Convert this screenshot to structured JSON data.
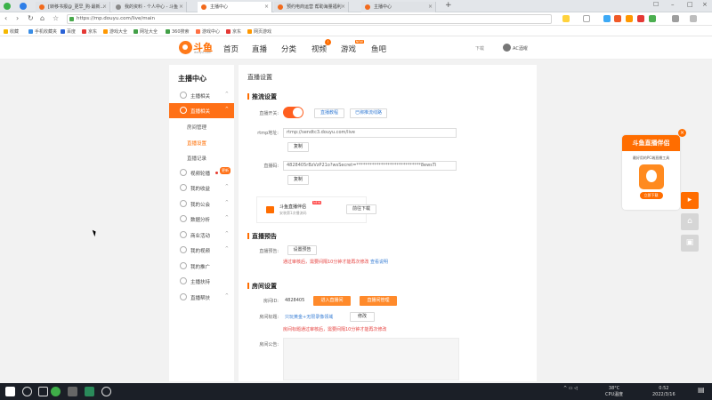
{
  "browser": {
    "tabs": [
      {
        "label": "[转移书报@_更早_购·最新...",
        "active": false
      },
      {
        "label": "我的资料 - 个人中心 - 斗鱼",
        "active": false
      },
      {
        "label": "主播中心",
        "active": true
      },
      {
        "label": "预约电商运营 帮助海量福利",
        "active": false
      },
      {
        "label": "主播中心",
        "active": false
      }
    ],
    "url": "https://mp.douyu.com/live/main",
    "bookmarks": [
      "收藏",
      "手机收藏夹",
      "百度",
      "京东",
      "游戏大全",
      "网址大全",
      "360搜索",
      "游戏中心",
      "京东",
      "网页游戏"
    ]
  },
  "site": {
    "logo_text": "斗鱼",
    "logo_sub": "douyu.com",
    "nav": [
      "首页",
      "直播",
      "分类",
      "视频",
      "游戏",
      "鱼吧"
    ],
    "video_badge": "!",
    "game_badge": "NEW",
    "download": "下载",
    "username": "AC酒曜"
  },
  "sidebar": {
    "title": "主播中心",
    "items": [
      {
        "label": "主播相关",
        "caret": "^"
      },
      {
        "label": "直播相关",
        "caret": "^"
      },
      {
        "label": "视频轮播",
        "caret": "^",
        "badge": "更新"
      },
      {
        "label": "我的收益",
        "caret": "^"
      },
      {
        "label": "我的公会",
        "caret": "^"
      },
      {
        "label": "数据分析",
        "caret": "^"
      },
      {
        "label": "商业活动",
        "caret": "^"
      },
      {
        "label": "我的视频",
        "caret": "^"
      },
      {
        "label": "我的推广",
        "caret": ""
      },
      {
        "label": "主播扶持",
        "caret": ""
      },
      {
        "label": "直播帮扶",
        "caret": "^"
      }
    ],
    "subitems": [
      "房间管理",
      "直播设置",
      "直播记录"
    ]
  },
  "main": {
    "page_title": "直播设置",
    "stream": {
      "section_title": "推流设置",
      "switch_label": "直播开关:",
      "tutorial_link": "直播教程",
      "third_party_link": "已绑推流线路",
      "rtmp_label": "rtmp地址:",
      "rtmp_value": "rtmp://sendtc3.douyu.com/live",
      "copy1": "复制",
      "code_label": "直播码:",
      "code_value": "4828405rBzVzP21o?wsSecret=*****************************8ewsTi",
      "copy2": "复制"
    },
    "promo": {
      "title": "斗鱼直播伴侣",
      "badge": "NEW",
      "desc": "安装第1次播流码",
      "button": "前往下载"
    },
    "notice": {
      "section_title": "直播预告",
      "label": "直播预告:",
      "button": "设置预告",
      "note": "通过审核后，需要间隔10分钟才能再次修改",
      "note_link": "查看说明"
    },
    "room": {
      "section_title": "房间设置",
      "id_label": "房间ID:",
      "id_value": "4828405",
      "btn_enter": "进入直播间",
      "btn_manage": "直播间管理",
      "title_label": "房间标题:",
      "title_value": "只玩黄金+无限录像领域",
      "edit": "修改",
      "note": "房间标题通过审核后，需要间隔10分钟才能再次修改",
      "announce_label": "房间公告:"
    }
  },
  "ad": {
    "title": "斗鱼直播伴侣",
    "desc": "最好用的PC端直播工具",
    "app_name": "DOUYU",
    "button": "立即下载"
  },
  "taskbar": {
    "temp": "38°C",
    "temp_label": "CPU温度",
    "time": "0:52",
    "date": "2022/3/16"
  },
  "colors": {
    "accent": "#ff6d00",
    "link": "#3a7fd5",
    "warning": "#e64340"
  }
}
